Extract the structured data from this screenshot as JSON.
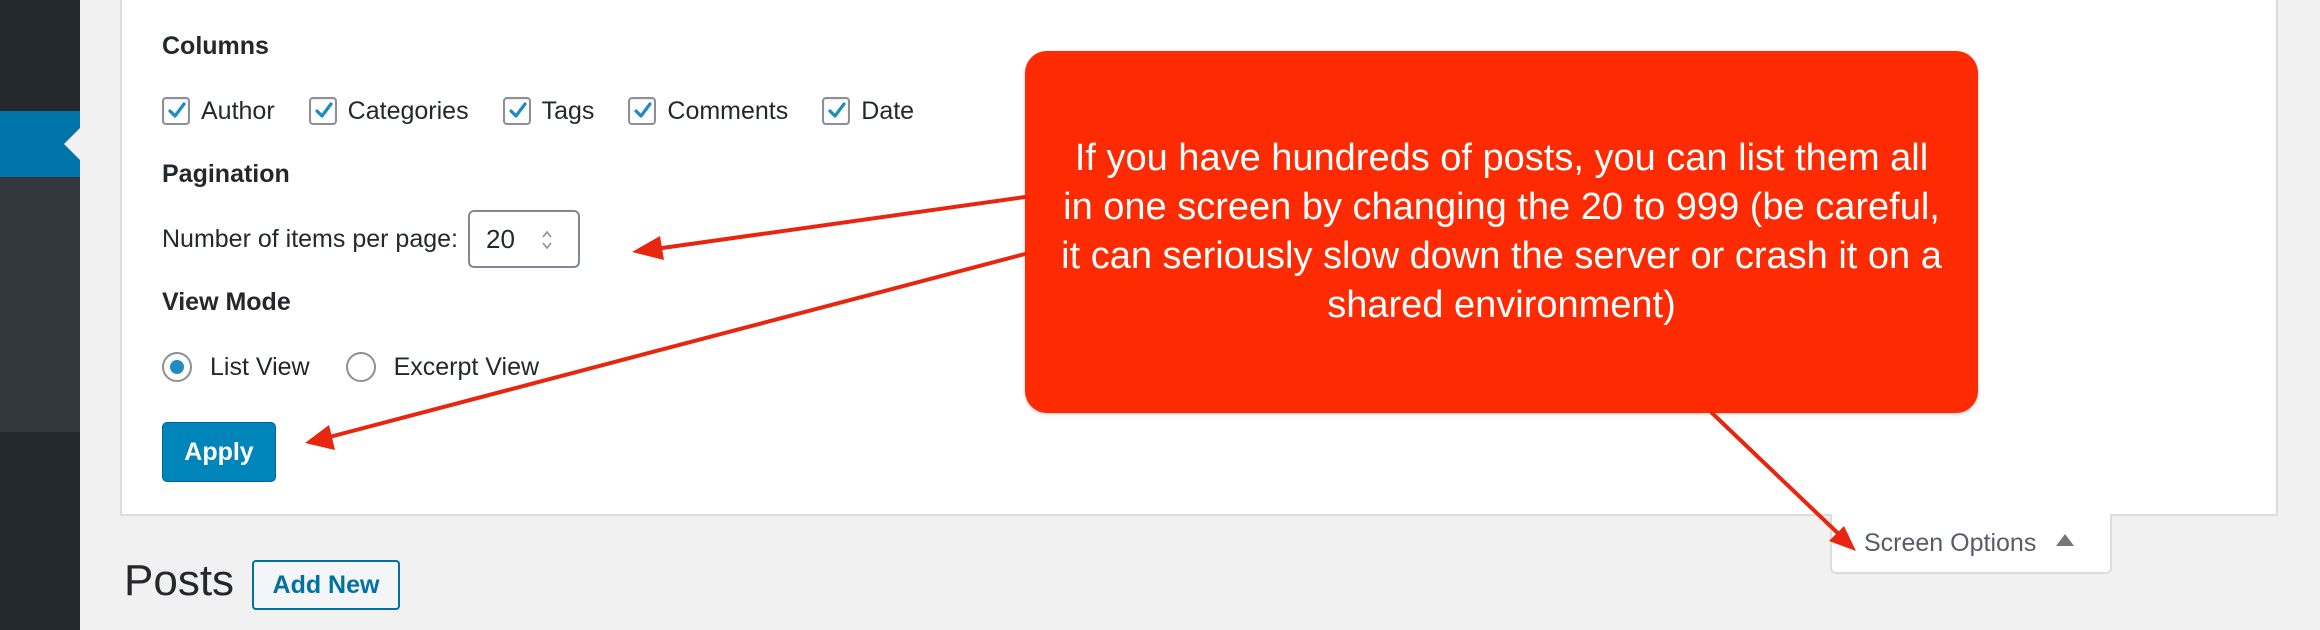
{
  "colors": {
    "sidebar": "#23282d",
    "sidebar_active": "#0073aa",
    "primary_button": "#0085ba",
    "callout": "#fe2a01",
    "annotation_arrow": "#e8260f"
  },
  "screen_options": {
    "columns": {
      "title": "Columns",
      "items": [
        {
          "label": "Author",
          "checked": true
        },
        {
          "label": "Categories",
          "checked": true
        },
        {
          "label": "Tags",
          "checked": true
        },
        {
          "label": "Comments",
          "checked": true
        },
        {
          "label": "Date",
          "checked": true
        }
      ]
    },
    "pagination": {
      "title": "Pagination",
      "items_label": "Number of items per page:",
      "items_value": "20"
    },
    "view_mode": {
      "title": "View Mode",
      "options": [
        {
          "label": "List View",
          "selected": true
        },
        {
          "label": "Excerpt View",
          "selected": false
        }
      ]
    },
    "apply_label": "Apply",
    "tab_label": "Screen Options"
  },
  "heading": {
    "title": "Posts",
    "add_new_label": "Add New"
  },
  "annotation": {
    "text": "If you have hundreds of posts, you can list them all in one screen by changing the 20 to 999 (be careful, it can seriously slow down the server or crash it on a shared environment)"
  }
}
